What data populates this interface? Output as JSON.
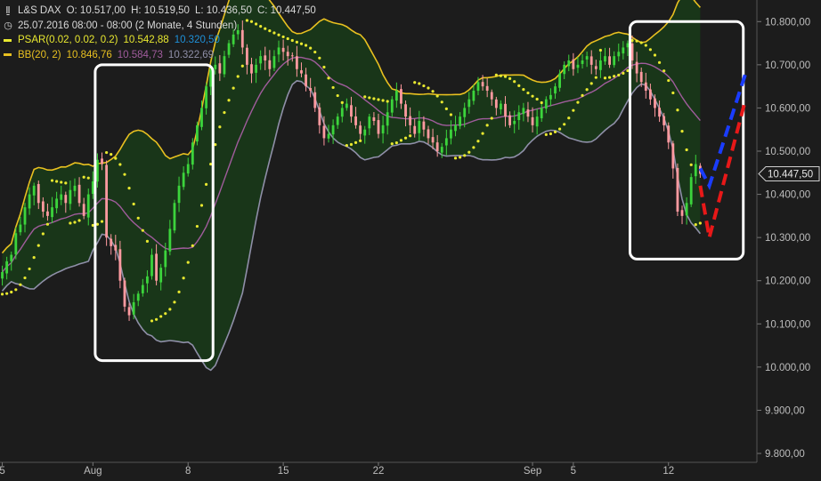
{
  "header": {
    "symbol": "L&S DAX",
    "ohlc": [
      {
        "label": "O:",
        "value": "10.517,00"
      },
      {
        "label": "H:",
        "value": "10.519,50"
      },
      {
        "label": "L:",
        "value": "10.436,50"
      },
      {
        "label": "C:",
        "value": "10.447,50"
      }
    ],
    "period": "25.07.2016 08:00 - 08:00 (2 Monate, 4 Stunden)"
  },
  "indicators": [
    {
      "name": "PSAR(0.02, 0.02, 0.2)",
      "values": [
        "10.542,88",
        "10.320,50"
      ],
      "value_colors": [
        "#e8e830",
        "#1e90d8"
      ],
      "color": "#e8e830"
    },
    {
      "name": "BB(20, 2)",
      "values": [
        "10.846,76",
        "10.584,73",
        "10.322,69"
      ],
      "value_colors": [
        "#e8c020",
        "#a05c9c",
        "#8f8fa8"
      ],
      "color": "#e8c020"
    }
  ],
  "colors": {
    "background": "#1c1c1c",
    "up_candle": "#3cd43c",
    "down_candle": "#ff9aa0",
    "psar": "#e8e830",
    "bb_upper": "#e8c020",
    "bb_middle": "#a05c9c",
    "bb_lower": "#8f8fa8",
    "bb_fill": "#1a3a1a",
    "forecast_blue": "#1a3cff",
    "forecast_red": "#e81818",
    "highlight_box": "#ffffff",
    "last_price_label_bg": "#1c1c1c"
  },
  "chart_data": {
    "type": "candlestick",
    "title": "L&S DAX",
    "ylim": [
      9800,
      10850
    ],
    "y_ticks": [
      "10.800,00",
      "10.700,00",
      "10.600,00",
      "10.500,00",
      "10.400,00",
      "10.300,00",
      "10.200,00",
      "10.100,00",
      "10.000,00",
      "9.900,00",
      "9.800,00"
    ],
    "y_tick_values": [
      10800,
      10700,
      10600,
      10500,
      10400,
      10300,
      10200,
      10100,
      10000,
      9900,
      9800
    ],
    "x_ticks": [
      {
        "label": "5",
        "bar": 0
      },
      {
        "label": "Aug",
        "bar": 20
      },
      {
        "label": "8",
        "bar": 41
      },
      {
        "label": "15",
        "bar": 62
      },
      {
        "label": "22",
        "bar": 83
      },
      {
        "label": "Sep",
        "bar": 117
      },
      {
        "label": "5",
        "bar": 126
      },
      {
        "label": "12",
        "bar": 147
      }
    ],
    "last_price": {
      "value": 10447.5,
      "label": "10.447,50"
    },
    "close": [
      10220,
      10245,
      10260,
      10310,
      10330,
      10370,
      10400,
      10420,
      10380,
      10360,
      10350,
      10370,
      10390,
      10400,
      10380,
      10410,
      10420,
      10380,
      10350,
      10400,
      10430,
      10480,
      10470,
      10300,
      10280,
      10270,
      10200,
      10140,
      10120,
      10150,
      10170,
      10190,
      10210,
      10260,
      10200,
      10230,
      10270,
      10320,
      10380,
      10420,
      10450,
      10470,
      10520,
      10560,
      10600,
      10650,
      10690,
      10700,
      10680,
      10720,
      10750,
      10770,
      10780,
      10740,
      10700,
      10680,
      10700,
      10720,
      10710,
      10690,
      10720,
      10740,
      10730,
      10720,
      10720,
      10690,
      10680,
      10650,
      10640,
      10600,
      10560,
      10530,
      10540,
      10560,
      10580,
      10600,
      10610,
      10580,
      10560,
      10540,
      10550,
      10580,
      10570,
      10540,
      10560,
      10590,
      10620,
      10640,
      10610,
      10580,
      10560,
      10540,
      10570,
      10550,
      10530,
      10520,
      10500,
      10510,
      10530,
      10550,
      10560,
      10580,
      10600,
      10620,
      10640,
      10660,
      10650,
      10640,
      10620,
      10600,
      10610,
      10580,
      10560,
      10570,
      10590,
      10600,
      10580,
      10560,
      10580,
      10600,
      10620,
      10630,
      10650,
      10680,
      10700,
      10710,
      10690,
      10700,
      10710,
      10720,
      10700,
      10690,
      10710,
      10720,
      10700,
      10720,
      10730,
      10740,
      10750,
      10710,
      10680,
      10660,
      10640,
      10620,
      10600,
      10580,
      10560,
      10520,
      10460,
      10360,
      10350,
      10380,
      10440,
      10470,
      10447.5
    ],
    "forecast": {
      "blue": [
        [
          154,
          10460
        ],
        [
          156,
          10420
        ],
        [
          164,
          10680
        ]
      ],
      "red": [
        [
          154,
          10420
        ],
        [
          156,
          10300
        ],
        [
          164,
          10620
        ]
      ]
    },
    "highlight_boxes": [
      {
        "from_bar": 21,
        "to_bar": 46,
        "top": 10700,
        "bottom": 10015
      },
      {
        "from_bar": 139,
        "to_bar": 163,
        "top": 10800,
        "bottom": 10250
      }
    ]
  }
}
